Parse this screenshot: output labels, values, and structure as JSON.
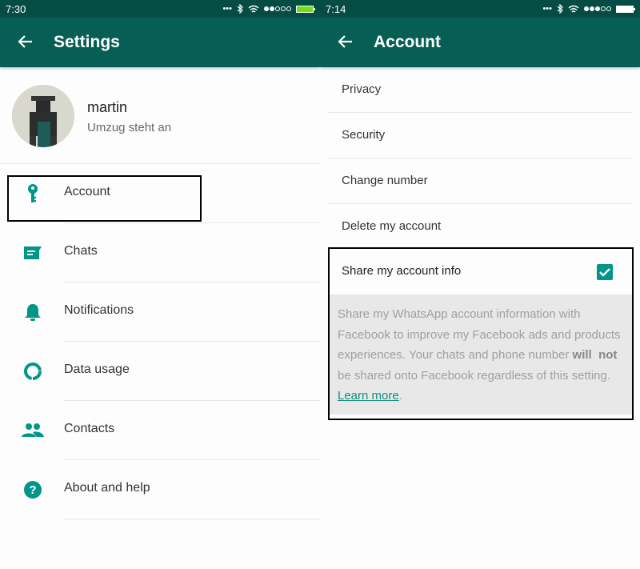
{
  "left_screen": {
    "statusbar": {
      "time": "7:30",
      "battery_color": "#6ee01a",
      "signal_filled": 2,
      "signal_total": 5
    },
    "appbar": {
      "title": "Settings"
    },
    "profile": {
      "name": "martin",
      "status": "Umzug steht an"
    },
    "menu": [
      {
        "label": "Account",
        "icon": "key-icon"
      },
      {
        "label": "Chats",
        "icon": "chat-icon"
      },
      {
        "label": "Notifications",
        "icon": "bell-icon"
      },
      {
        "label": "Data usage",
        "icon": "data-usage-icon"
      },
      {
        "label": "Contacts",
        "icon": "contacts-icon"
      },
      {
        "label": "About and help",
        "icon": "help-icon"
      }
    ]
  },
  "right_screen": {
    "statusbar": {
      "time": "7:14",
      "battery_color": "#ffffff",
      "signal_filled": 3,
      "signal_total": 5
    },
    "appbar": {
      "title": "Account"
    },
    "items": [
      {
        "label": "Privacy"
      },
      {
        "label": "Security"
      },
      {
        "label": "Change number"
      },
      {
        "label": "Delete my account"
      }
    ],
    "share": {
      "label": "Share my account info",
      "checked": true,
      "desc_part1": "Share my WhatsApp account information with Facebook to improve my Facebook ads and products experiences. Your chats and phone number ",
      "desc_will": "will",
      "desc_not": "not",
      "desc_part2": " be shared onto Facebook regardless of this setting. ",
      "learn_more": "Learn more",
      "desc_end": "."
    }
  },
  "colors": {
    "statusbar": "#054d44",
    "appbar": "#075e54",
    "accent": "#009688",
    "link": "#128c7e"
  }
}
